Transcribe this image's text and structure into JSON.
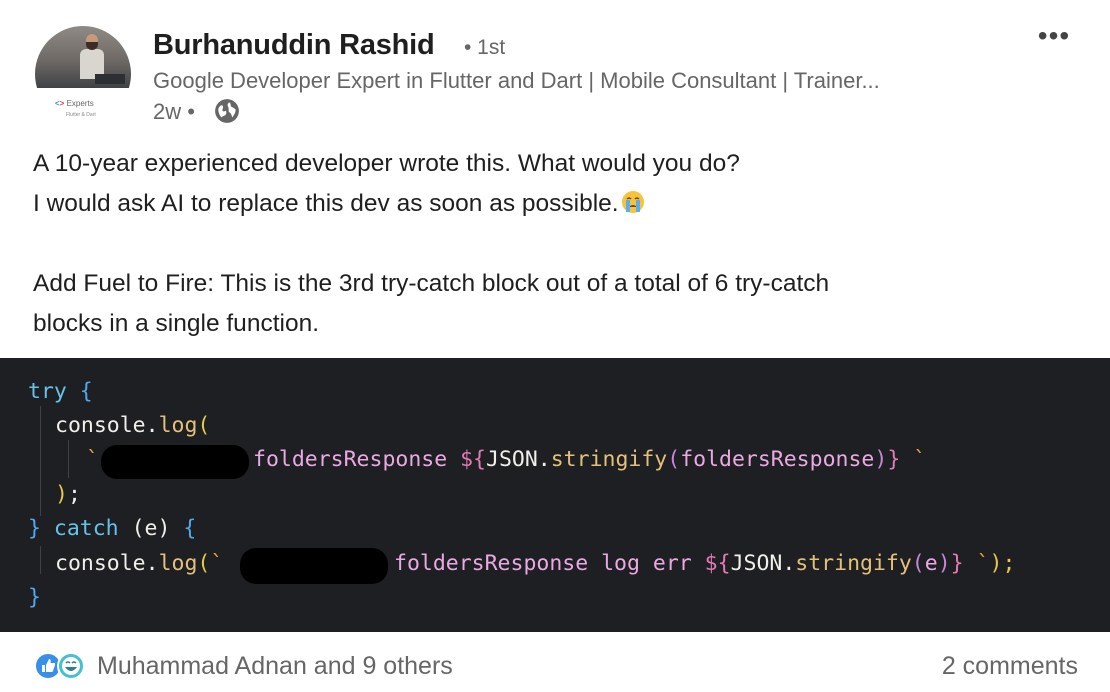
{
  "post": {
    "author": {
      "name": "Burhanuddin Rashid",
      "degree": "• 1st",
      "headline": "Google Developer Expert in Flutter and Dart | Mobile Consultant | Trainer...",
      "time": "2w •",
      "avatar_badge": "Experts",
      "avatar_badge_sub": "Flutter & Dart"
    },
    "more_label": "•••",
    "text_lines": [
      "A 10-year experienced developer wrote this. What would you do?",
      "I would ask AI to replace this dev as soon as possible.",
      "",
      "Add Fuel to Fire: This is the 3rd try-catch block out of a total of 6 try-catch",
      "blocks in a single function."
    ],
    "code": {
      "try_kw": "try",
      "open_brace": "{",
      "console": "console.",
      "log": "log",
      "open_paren": "(",
      "backtick": "`",
      "line3_text": "foldersResponse ",
      "tmpl_open": "${",
      "json": "JSON.",
      "stringify": "stringify",
      "arg1": "foldersResponse",
      "close_paren": ")",
      "tmpl_close": "}",
      "semicolon": ";",
      "close_brace": "}",
      "catch_kw": "catch",
      "err_var": "e",
      "line6_text": "foldersResponse log err ",
      "tail_backtick": " `",
      "tail": ");"
    },
    "footer": {
      "reactions_label": "Muhammad Adnan and 9 others",
      "comments_label": "2 comments"
    }
  }
}
